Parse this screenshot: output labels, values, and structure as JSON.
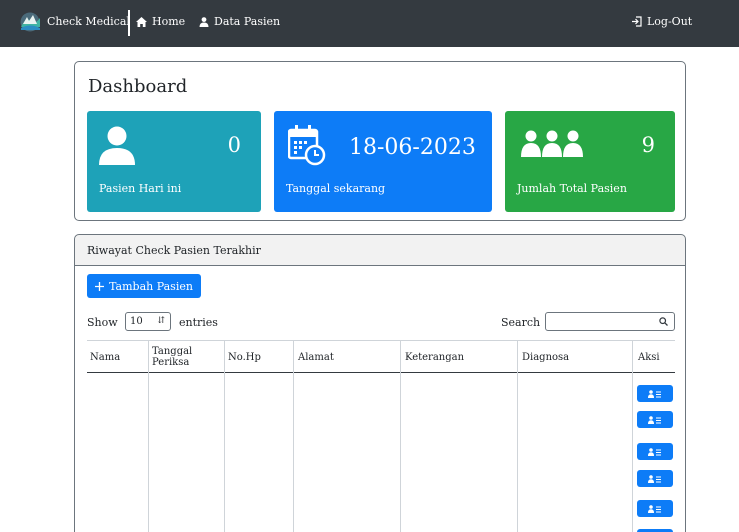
{
  "navbar": {
    "brand": "Check Medical",
    "home": "Home",
    "data_pasien": "Data Pasien",
    "logout": "Log-Out",
    "bg_color": "#343a40"
  },
  "dashboard": {
    "title": "Dashboard",
    "stats": [
      {
        "value": "0",
        "label": "Pasien Hari ini",
        "icon": "user-icon",
        "color": "#1ea2b8"
      },
      {
        "value": "18-06-2023",
        "label": "Tanggal sekarang",
        "icon": "calendar-clock-icon",
        "color": "#0d7cf7"
      },
      {
        "value": "9",
        "label": "Jumlah Total Pasien",
        "icon": "users-icon",
        "color": "#28a745"
      }
    ]
  },
  "riwayat": {
    "title": "Riwayat Check Pasien Terakhir",
    "add_button": "Tambah Pasien",
    "show_label": "Show",
    "show_value": "10",
    "entries_label": "entries",
    "search_label": "Search",
    "search_value": "",
    "columns": [
      "Nama",
      "Tanggal Periksa",
      "No.Hp",
      "Alamat",
      "Keterangan",
      "Diagnosa",
      "Aksi"
    ],
    "aksi_icon": "user-list-icon"
  }
}
